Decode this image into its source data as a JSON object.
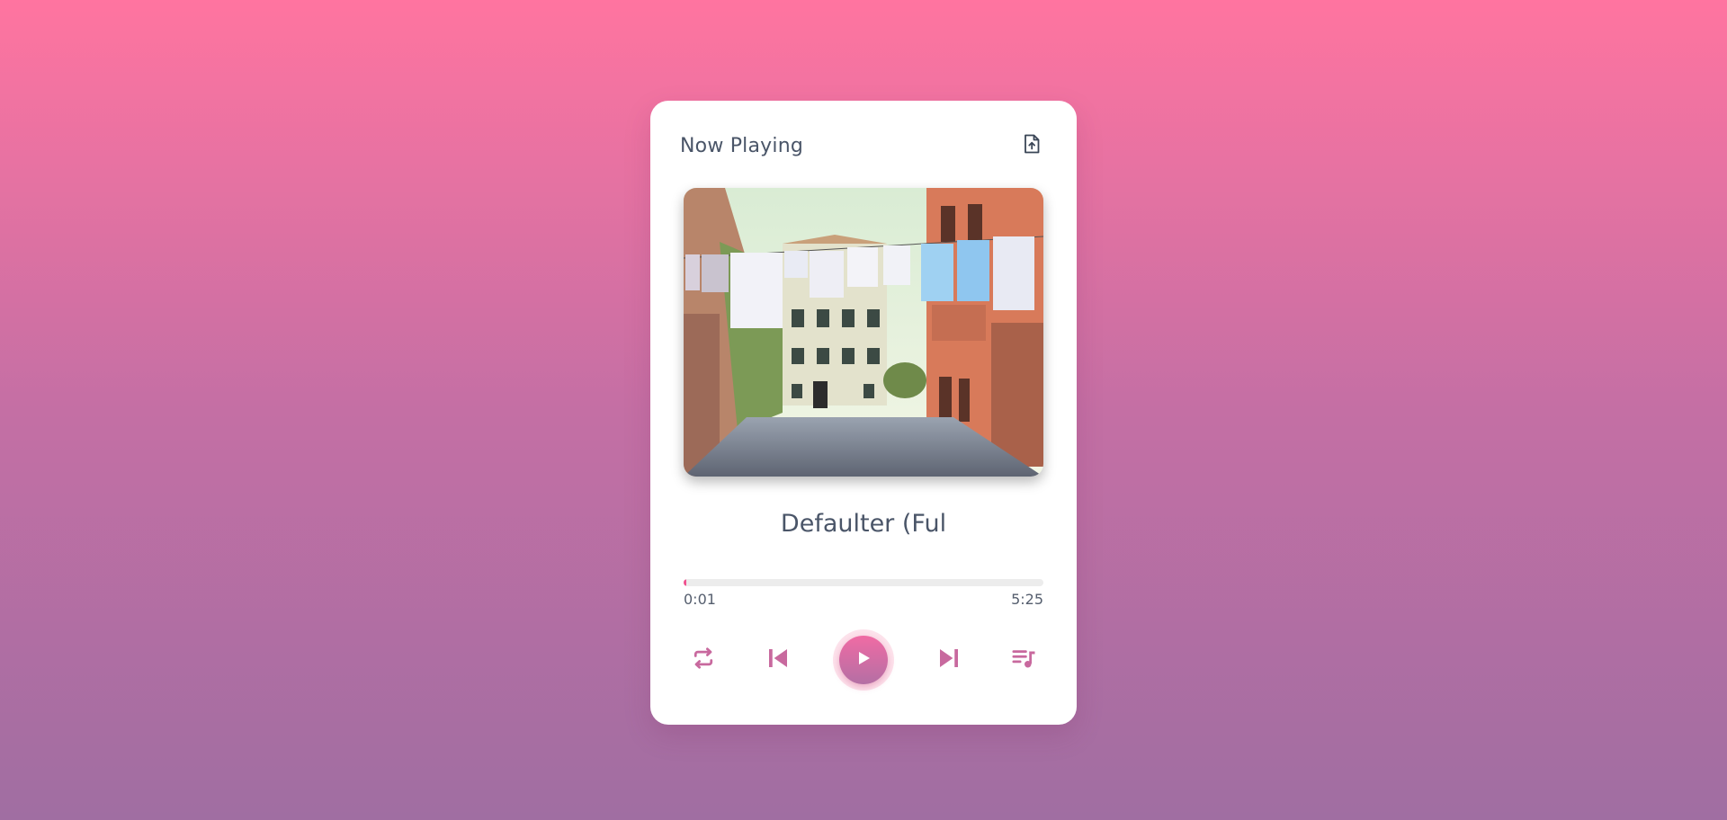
{
  "header": {
    "title": "Now Playing",
    "upload_icon": "file-upload-icon"
  },
  "track": {
    "title": "Defaulter (Ful",
    "cover_art": "album-cover-street-laundry"
  },
  "progress": {
    "current_time": "0:01",
    "total_time": "5:25",
    "fraction": 0.003
  },
  "controls": {
    "repeat_icon": "repeat-icon",
    "previous_icon": "skip-previous-icon",
    "play_icon": "play-icon",
    "next_icon": "skip-next-icon",
    "playlist_icon": "playlist-icon"
  },
  "colors": {
    "accent": "#f0518f",
    "icon": "#c8699e",
    "background_top": "#ff74a0",
    "background_bottom": "#a06ea2"
  }
}
